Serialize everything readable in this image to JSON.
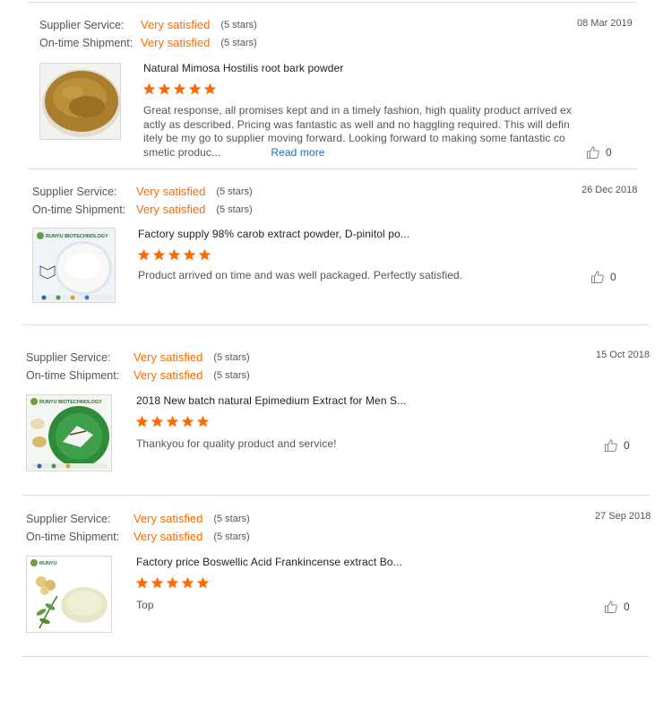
{
  "labels": {
    "supplier_service": "Supplier Service:",
    "ontime_shipment": "On-time Shipment:",
    "read_more": "Read more"
  },
  "colors": {
    "accent": "#ff6a00",
    "link": "#1a6ec0",
    "divider": "#dcdcdc"
  },
  "reviews": [
    {
      "date": "08 Mar 2019",
      "supplier_service": "Very satisfied",
      "supplier_service_stars": "(5 stars)",
      "ontime_shipment": "Very satisfied",
      "ontime_shipment_stars": "(5 stars)",
      "product_title": "Natural Mimosa Hostilis root bark powder",
      "rating": 5,
      "text": "Great response, all promises kept and in a timely fashion, high quality product arrived ex actly as described. Pricing was fantastic as well and no haggling required. This will defin itely be my go to supplier moving forward. Looking forward to making some fantastic co smetic produc...",
      "likes": "0"
    },
    {
      "date": "26 Dec 2018",
      "supplier_service": "Very satisfied",
      "supplier_service_stars": "(5 stars)",
      "ontime_shipment": "Very satisfied",
      "ontime_shipment_stars": "(5 stars)",
      "product_title": "Factory supply 98% carob extract powder, D-pinitol po...",
      "rating": 5,
      "text": "Product arrived on time and was well packaged. Perfectly satisfied.",
      "likes": "0",
      "thumb_brand": "RUNYU BIOTECHNOLOGY"
    },
    {
      "date": "15 Oct 2018",
      "supplier_service": "Very satisfied",
      "supplier_service_stars": "(5 stars)",
      "ontime_shipment": "Very satisfied",
      "ontime_shipment_stars": "(5 stars)",
      "product_title": "2018 New batch natural Epimedium Extract for Men S...",
      "rating": 5,
      "text": "Thankyou for quality product and service!",
      "likes": "0",
      "thumb_brand": "RUNYU BIOTECHNOLOGY"
    },
    {
      "date": "27 Sep 2018",
      "supplier_service": "Very satisfied",
      "supplier_service_stars": "(5 stars)",
      "ontime_shipment": "Very satisfied",
      "ontime_shipment_stars": "(5 stars)",
      "product_title": "Factory price Boswellic Acid Frankincense extract Bo...",
      "rating": 5,
      "text": "Top",
      "likes": "0",
      "thumb_brand": "RUNYU"
    }
  ]
}
